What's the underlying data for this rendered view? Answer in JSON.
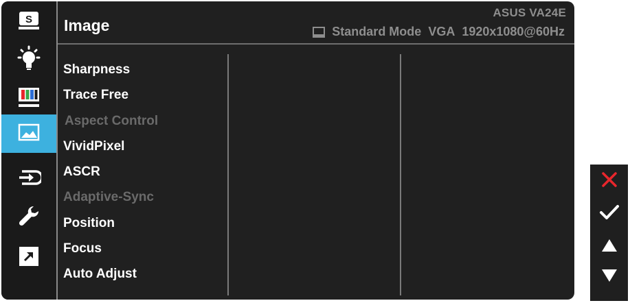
{
  "header": {
    "title": "Image",
    "model": "ASUS  VA24E",
    "status": {
      "mode": "Standard Mode",
      "input": "VGA",
      "resolution": "1920x1080@60Hz"
    }
  },
  "sidebar": {
    "items": [
      {
        "name": "splendid",
        "icon": "splendid-s-icon",
        "glyph": "S",
        "active": false
      },
      {
        "name": "blue-light-filter",
        "icon": "light-bulb-icon",
        "active": false
      },
      {
        "name": "color",
        "icon": "color-bars-icon",
        "active": false
      },
      {
        "name": "image",
        "icon": "image-landscape-icon",
        "active": true
      },
      {
        "name": "input-select",
        "icon": "input-select-icon",
        "active": false
      },
      {
        "name": "system-setup",
        "icon": "wrench-icon",
        "active": false
      },
      {
        "name": "shortcut",
        "icon": "shortcut-arrow-icon",
        "active": false
      }
    ]
  },
  "menu": {
    "items": [
      {
        "label": "Sharpness",
        "enabled": true
      },
      {
        "label": "Trace Free",
        "enabled": true
      },
      {
        "label": "Aspect Control",
        "enabled": false
      },
      {
        "label": "VividPixel",
        "enabled": true
      },
      {
        "label": "ASCR",
        "enabled": true
      },
      {
        "label": "Adaptive-Sync",
        "enabled": false
      },
      {
        "label": "Position",
        "enabled": true
      },
      {
        "label": "Focus",
        "enabled": true
      },
      {
        "label": "Auto Adjust",
        "enabled": true
      }
    ]
  },
  "keys": [
    {
      "name": "close-icon",
      "color": "#e8262c"
    },
    {
      "name": "checkmark-icon",
      "color": "#ffffff"
    },
    {
      "name": "arrow-up-icon",
      "color": "#ffffff"
    },
    {
      "name": "arrow-down-icon",
      "color": "#ffffff"
    }
  ],
  "colors": {
    "accent": "#3db1df",
    "panel": "#202020",
    "disabled_text": "#6a6a6a",
    "secondary_text": "#8e8e8e",
    "close_red": "#e8262c"
  }
}
